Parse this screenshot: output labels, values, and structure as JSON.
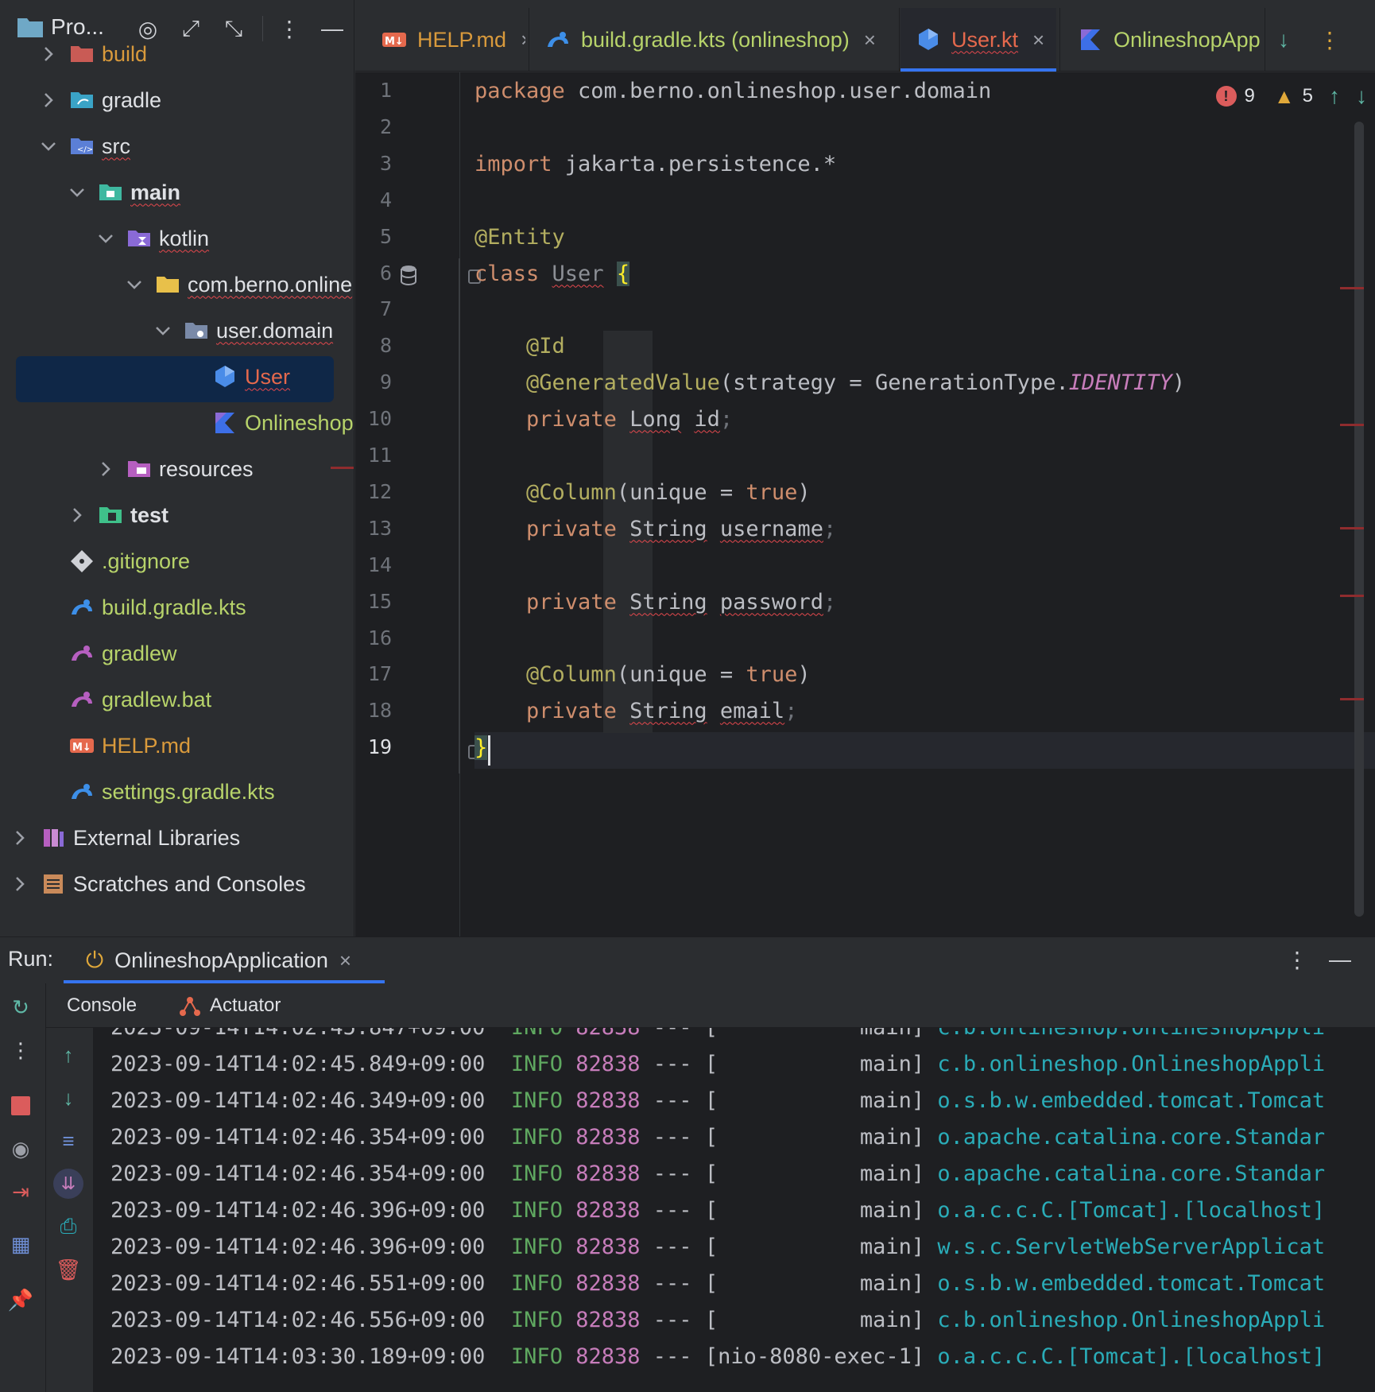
{
  "project_panel": {
    "title": "Pro...",
    "tree": [
      {
        "label": "build",
        "depth": 1,
        "chevron": "right",
        "icon": "folder-excluded-icon",
        "style": "orange"
      },
      {
        "label": "gradle",
        "depth": 1,
        "chevron": "right",
        "icon": "gradle-folder-icon"
      },
      {
        "label": "src",
        "depth": 1,
        "chevron": "down",
        "icon": "source-folder-icon",
        "squiggle": true
      },
      {
        "label": "main",
        "depth": 2,
        "chevron": "down",
        "icon": "folder-main-icon",
        "bold": true,
        "squiggle": true
      },
      {
        "label": "kotlin",
        "depth": 3,
        "chevron": "down",
        "icon": "kotlin-folder-icon",
        "squiggle": true
      },
      {
        "label": "com.berno.online",
        "depth": 4,
        "chevron": "down",
        "icon": "package-folder-icon",
        "squiggle": true
      },
      {
        "label": "user.domain",
        "depth": 5,
        "chevron": "down",
        "icon": "package-icon",
        "squiggle": true
      },
      {
        "label": "User",
        "depth": 6,
        "chevron": "none",
        "icon": "kotlin-class-icon",
        "selected": true,
        "squiggle": true
      },
      {
        "label": "OnlineshopApp",
        "depth": 6,
        "chevron": "none",
        "icon": "kotlin-file-icon",
        "style": "green"
      },
      {
        "label": "resources",
        "depth": 3,
        "chevron": "right",
        "icon": "resources-folder-icon"
      },
      {
        "label": "test",
        "depth": 2,
        "chevron": "right",
        "icon": "test-folder-icon",
        "bold": true
      },
      {
        "label": ".gitignore",
        "depth": 1,
        "chevron": "none",
        "icon": "git-icon",
        "style": "green"
      },
      {
        "label": "build.gradle.kts",
        "depth": 1,
        "chevron": "none",
        "icon": "gradle-icon",
        "style": "green"
      },
      {
        "label": "gradlew",
        "depth": 1,
        "chevron": "none",
        "icon": "gradle-purple-icon",
        "style": "green"
      },
      {
        "label": "gradlew.bat",
        "depth": 1,
        "chevron": "none",
        "icon": "gradle-purple-icon",
        "style": "green"
      },
      {
        "label": "HELP.md",
        "depth": 1,
        "chevron": "none",
        "icon": "markdown-icon",
        "style": "orange"
      },
      {
        "label": "settings.gradle.kts",
        "depth": 1,
        "chevron": "none",
        "icon": "gradle-icon",
        "style": "green"
      },
      {
        "label": "External Libraries",
        "depth": 0,
        "chevron": "right",
        "icon": "library-icon"
      },
      {
        "label": "Scratches and Consoles",
        "depth": 0,
        "chevron": "right",
        "icon": "scratches-icon"
      }
    ]
  },
  "tabs": [
    {
      "label": "HELP.md",
      "icon": "markdown-icon",
      "color": "#d99a3c",
      "active": false
    },
    {
      "label": "build.gradle.kts (onlineshop)",
      "icon": "gradle-icon",
      "color": "#b7d36a",
      "active": false
    },
    {
      "label": "User.kt",
      "icon": "kotlin-class-icon",
      "color": "#e5694d",
      "active": true
    },
    {
      "label": "OnlineshopAppli",
      "icon": "kotlin-file-icon",
      "color": "#b7d36a",
      "active": false
    }
  ],
  "inspections": {
    "errors": "9",
    "warnings": "5"
  },
  "editor": {
    "current_line": 19,
    "lines": [
      {
        "n": "1",
        "tokens": [
          [
            "kw",
            "package"
          ],
          [
            "txt",
            " com.berno.onlineshop.user.domain"
          ]
        ]
      },
      {
        "n": "2",
        "tokens": []
      },
      {
        "n": "3",
        "tokens": [
          [
            "kw",
            "import"
          ],
          [
            "txt",
            " jakarta.persistence.*"
          ]
        ]
      },
      {
        "n": "4",
        "tokens": []
      },
      {
        "n": "5",
        "tokens": [
          [
            "ann",
            "@Entity"
          ]
        ]
      },
      {
        "n": "6",
        "tokens": [
          [
            "kw",
            "class"
          ],
          [
            "txt",
            " "
          ],
          [
            "grey squig",
            "User"
          ],
          [
            "txt",
            " "
          ],
          [
            "brace-y",
            "{"
          ]
        ]
      },
      {
        "n": "7",
        "tokens": []
      },
      {
        "n": "8",
        "tokens": [
          [
            "txt",
            "    "
          ],
          [
            "ann",
            "@Id"
          ]
        ]
      },
      {
        "n": "9",
        "tokens": [
          [
            "txt",
            "    "
          ],
          [
            "ann",
            "@GeneratedValue"
          ],
          [
            "punct",
            "(strategy = GenerationType."
          ],
          [
            "enum",
            "IDENTITY"
          ],
          [
            "punct",
            ")"
          ]
        ]
      },
      {
        "n": "10",
        "tokens": [
          [
            "txt",
            "    "
          ],
          [
            "kw",
            "private"
          ],
          [
            "txt",
            " "
          ],
          [
            "cls squig",
            "Long"
          ],
          [
            "txt",
            " "
          ],
          [
            "txt squig",
            "id"
          ],
          [
            "semi",
            ";"
          ]
        ]
      },
      {
        "n": "11",
        "tokens": []
      },
      {
        "n": "12",
        "tokens": [
          [
            "txt",
            "    "
          ],
          [
            "ann",
            "@Column"
          ],
          [
            "punct",
            "(unique = "
          ],
          [
            "kw",
            "true"
          ],
          [
            "punct",
            ")"
          ]
        ]
      },
      {
        "n": "13",
        "tokens": [
          [
            "txt",
            "    "
          ],
          [
            "kw",
            "private"
          ],
          [
            "txt",
            " "
          ],
          [
            "cls squig",
            "String"
          ],
          [
            "txt",
            " "
          ],
          [
            "txt squig",
            "username"
          ],
          [
            "semi",
            ";"
          ]
        ]
      },
      {
        "n": "14",
        "tokens": []
      },
      {
        "n": "15",
        "tokens": [
          [
            "txt",
            "    "
          ],
          [
            "kw",
            "private"
          ],
          [
            "txt",
            " "
          ],
          [
            "cls squig",
            "String"
          ],
          [
            "txt",
            " "
          ],
          [
            "txt squig",
            "password"
          ],
          [
            "semi",
            ";"
          ]
        ]
      },
      {
        "n": "16",
        "tokens": []
      },
      {
        "n": "17",
        "tokens": [
          [
            "txt",
            "    "
          ],
          [
            "ann",
            "@Column"
          ],
          [
            "punct",
            "(unique = "
          ],
          [
            "kw",
            "true"
          ],
          [
            "punct",
            ")"
          ]
        ]
      },
      {
        "n": "18",
        "tokens": [
          [
            "txt",
            "    "
          ],
          [
            "kw",
            "private"
          ],
          [
            "txt",
            " "
          ],
          [
            "cls squig",
            "String"
          ],
          [
            "txt",
            " "
          ],
          [
            "txt squig",
            "email"
          ],
          [
            "semi",
            ";"
          ]
        ]
      },
      {
        "n": "19",
        "tokens": [
          [
            "brace-y",
            "}"
          ]
        ]
      }
    ]
  },
  "run": {
    "label": "Run:",
    "config": "OnlineshopApplication",
    "subtabs": [
      "Console",
      "Actuator"
    ],
    "log": [
      {
        "ts": "2023-09-14T14:02:45.849+09:00",
        "level": "INFO",
        "pid": "82838",
        "sep": "---",
        "thread": "[           main]",
        "logger": "c.b.onlineshop.OnlineshopAppli"
      },
      {
        "ts": "2023-09-14T14:02:46.349+09:00",
        "level": "INFO",
        "pid": "82838",
        "sep": "---",
        "thread": "[           main]",
        "logger": "o.s.b.w.embedded.tomcat.Tomcat"
      },
      {
        "ts": "2023-09-14T14:02:46.354+09:00",
        "level": "INFO",
        "pid": "82838",
        "sep": "---",
        "thread": "[           main]",
        "logger": "o.apache.catalina.core.Standar"
      },
      {
        "ts": "2023-09-14T14:02:46.354+09:00",
        "level": "INFO",
        "pid": "82838",
        "sep": "---",
        "thread": "[           main]",
        "logger": "o.apache.catalina.core.Standar"
      },
      {
        "ts": "2023-09-14T14:02:46.396+09:00",
        "level": "INFO",
        "pid": "82838",
        "sep": "---",
        "thread": "[           main]",
        "logger": "o.a.c.c.C.[Tomcat].[localhost]"
      },
      {
        "ts": "2023-09-14T14:02:46.396+09:00",
        "level": "INFO",
        "pid": "82838",
        "sep": "---",
        "thread": "[           main]",
        "logger": "w.s.c.ServletWebServerApplicat"
      },
      {
        "ts": "2023-09-14T14:02:46.551+09:00",
        "level": "INFO",
        "pid": "82838",
        "sep": "---",
        "thread": "[           main]",
        "logger": "o.s.b.w.embedded.tomcat.Tomcat"
      },
      {
        "ts": "2023-09-14T14:02:46.556+09:00",
        "level": "INFO",
        "pid": "82838",
        "sep": "---",
        "thread": "[           main]",
        "logger": "c.b.onlineshop.OnlineshopAppli"
      },
      {
        "ts": "2023-09-14T14:03:30.189+09:00",
        "level": "INFO",
        "pid": "82838",
        "sep": "---",
        "thread": "[nio-8080-exec-1]",
        "logger": "o.a.c.c.C.[Tomcat].[localhost]"
      }
    ]
  }
}
